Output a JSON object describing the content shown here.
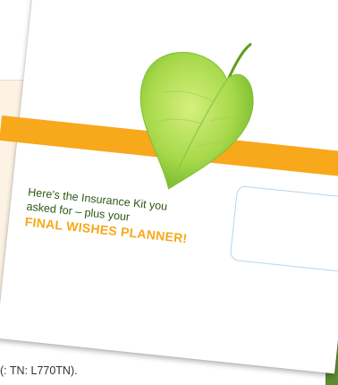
{
  "mailer": {
    "message_line1": "Here's the Insurance Kit you",
    "message_line2": "asked for – plus your",
    "message_accent": "FINAL WISHES PLANNER!"
  },
  "caption": "(: TN: L770TN).",
  "colors": {
    "green_stripe": "#5c8c2f",
    "orange_band": "#f7a81b",
    "accent_text": "#f7a81b",
    "message_text": "#2c5a14",
    "cream_panel": "#fcf3e4",
    "address_window_border": "#b8d4e8",
    "leaf_light": "#bfe36a",
    "leaf_dark": "#6fb52a"
  },
  "icons": {
    "leaf": "heart-leaf-icon"
  }
}
